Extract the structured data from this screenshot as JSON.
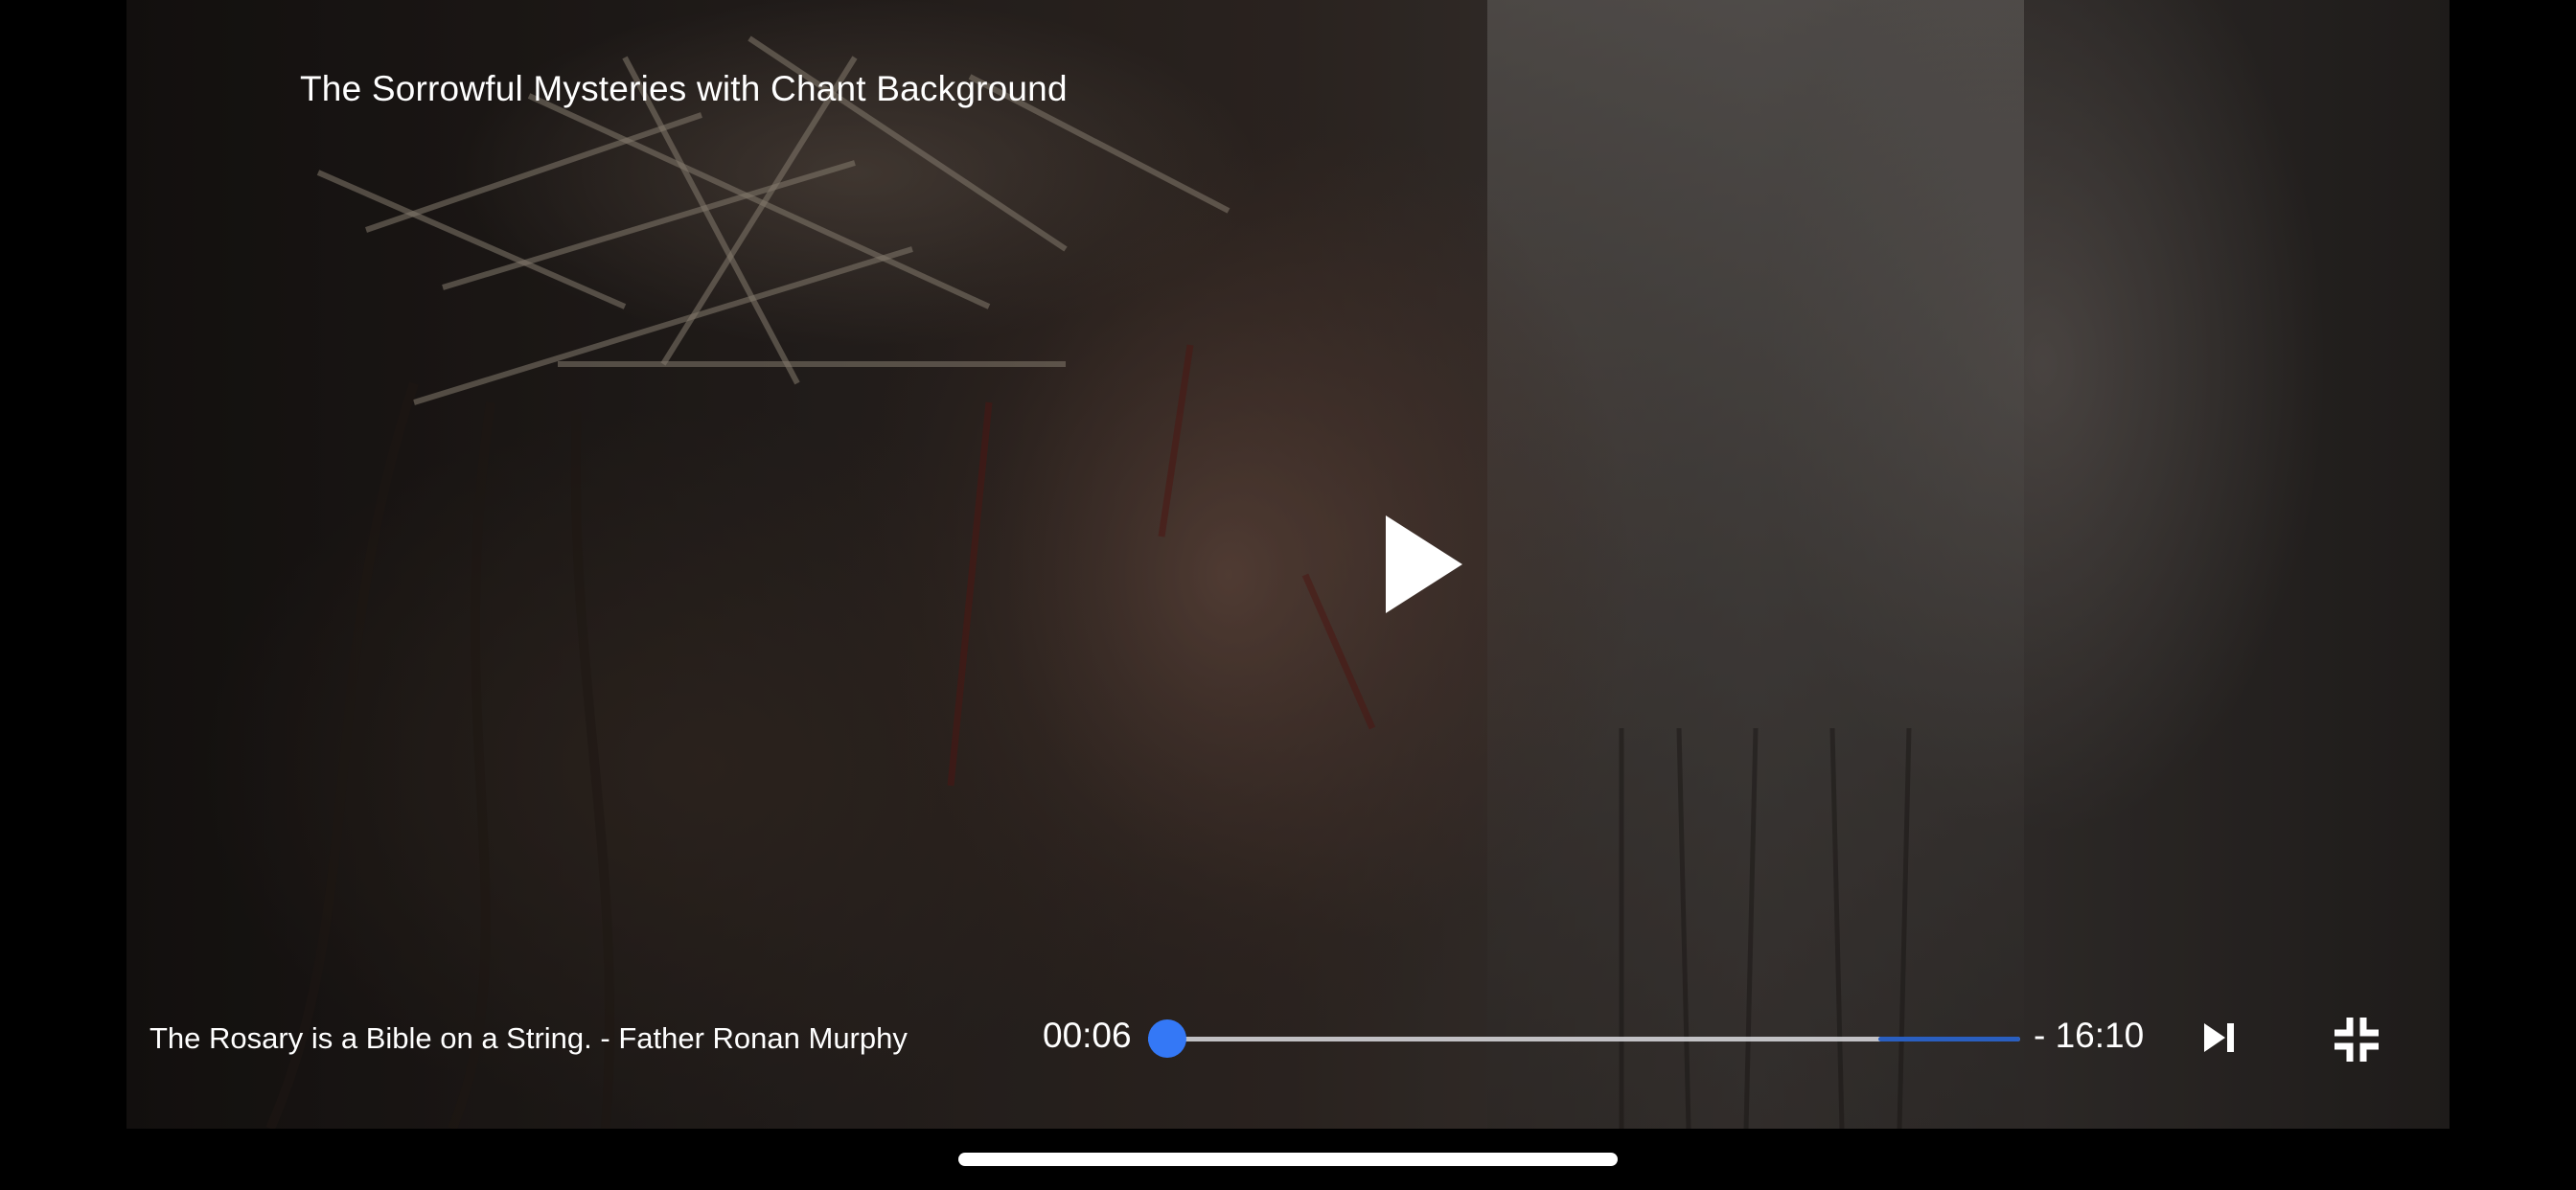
{
  "video": {
    "title": "The Sorrowful Mysteries with Chant Background",
    "caption": "The Rosary is a Bible on a String. - Father Ronan Murphy",
    "is_favorite": false,
    "state": "paused"
  },
  "playback": {
    "elapsed": "00:06",
    "remaining": "- 16:10",
    "progress_fraction": 0.006,
    "buffered_fraction": 0.92
  },
  "colors": {
    "accent": "#3478f6",
    "buffer": "#2a5fc0",
    "track": "#dcdce1",
    "text": "#ffffff"
  },
  "icons": {
    "favorite": "heart-outline-icon",
    "play": "play-icon",
    "next": "skip-next-icon",
    "exit_fullscreen": "exit-fullscreen-icon"
  }
}
